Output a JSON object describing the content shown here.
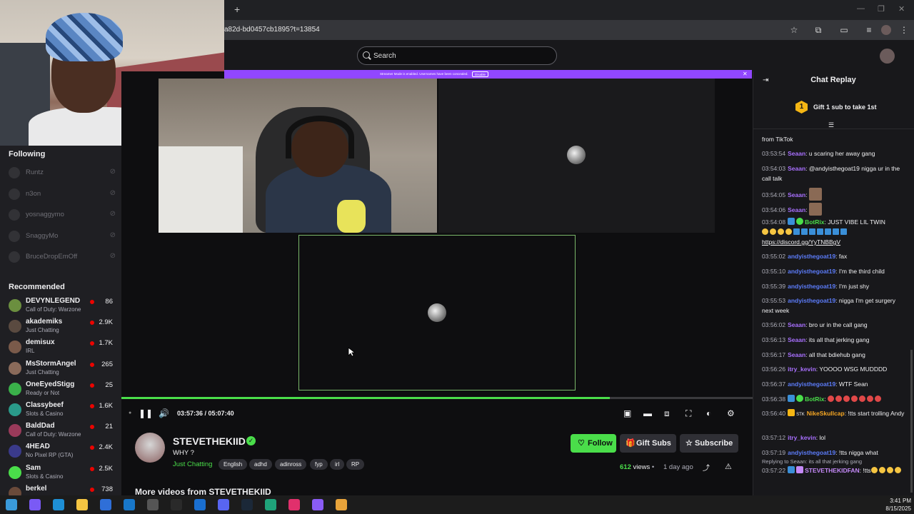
{
  "browser": {
    "url": "a82d-bd0457cb1895?t=13854",
    "new_tab": "+"
  },
  "header": {
    "search_placeholder": "Search"
  },
  "banner": {
    "text": "Streamer Mode is enabled. Usernames have been concealed.",
    "button": "Disable"
  },
  "sidebar": {
    "following_heading": "Following",
    "following": [
      {
        "name": "Runtz"
      },
      {
        "name": "n3on"
      },
      {
        "name": "yosnaggymo"
      },
      {
        "name": "SnaggyMo"
      },
      {
        "name": "BruceDropEmOff"
      }
    ],
    "recommended_heading": "Recommended",
    "recommended": [
      {
        "name": "DEVYNLEGEND",
        "category": "Call of Duty: Warzone",
        "viewers": "86",
        "color": "#6b8f3f"
      },
      {
        "name": "akademiks",
        "category": "Just Chatting",
        "viewers": "2.9K",
        "color": "#5a4a40"
      },
      {
        "name": "demisux",
        "category": "IRL",
        "viewers": "1.7K",
        "color": "#7a5a4a"
      },
      {
        "name": "MsStormAngel",
        "category": "Just Chatting",
        "viewers": "265",
        "color": "#8a6a5a"
      },
      {
        "name": "OneEyedStigg",
        "category": "Ready or Not",
        "viewers": "25",
        "color": "#3ab04a"
      },
      {
        "name": "Classybeef",
        "category": "Slots & Casino",
        "viewers": "1.6K",
        "color": "#2a9a8a"
      },
      {
        "name": "BaldDad",
        "category": "Call of Duty: Warzone",
        "viewers": "21",
        "color": "#9a3a5a"
      },
      {
        "name": "4HEAD",
        "category": "No Pixel RP (GTA)",
        "viewers": "2.4K",
        "color": "#3a3a8a"
      },
      {
        "name": "Sam",
        "category": "Slots & Casino",
        "viewers": "2.5K",
        "color": "#4ade4a"
      },
      {
        "name": "berkel",
        "category": "",
        "viewers": "738",
        "color": "#6a4a3a"
      }
    ]
  },
  "player": {
    "time_current": "03:57:36",
    "time_total": "05:07:40",
    "time_sep": " / ",
    "progress": 0.774
  },
  "channel": {
    "name": "STEVETHEKIID",
    "title": "WHY ?",
    "category": "Just Chatting",
    "tags": [
      "English",
      "adhd",
      "adinross",
      "fyp",
      "irl",
      "RP"
    ],
    "follow": "Follow",
    "gift": "Gift Subs",
    "subscribe": "Subscribe",
    "views": "612",
    "views_label": " views",
    "bullet": "•",
    "ago": "1 day ago",
    "more_videos": "More videos from STEVETHEKIID"
  },
  "chat": {
    "title": "Chat Replay",
    "gift_rank": "1",
    "gift_text": "Gift 1 sub to take 1st",
    "messages": [
      {
        "ts": "",
        "user": "",
        "color": "#9147ff",
        "text": "from TikTok"
      },
      {
        "ts": "03:53:54",
        "user": "Seaan",
        "color": "#a970ff",
        "text": "u scaring her away gang"
      },
      {
        "ts": "03:54:03",
        "user": "Seaan",
        "color": "#a970ff",
        "text": "@andyisthegoat19 nigga ur in the call talk"
      },
      {
        "ts": "03:54:05",
        "user": "Seaan",
        "color": "#a970ff",
        "text": ""
      },
      {
        "ts": "03:54:06",
        "user": "Seaan",
        "color": "#a970ff",
        "text": ""
      },
      {
        "ts": "03:54:08",
        "user": "BotRix",
        "color": "#4ade4a",
        "text": "JUST VIBE LIL TWIN",
        "link": "https://discord.gg/YyTNBBgV"
      },
      {
        "ts": "03:55:02",
        "user": "andyisthegoat19",
        "color": "#5c7cfa",
        "text": "fax"
      },
      {
        "ts": "03:55:10",
        "user": "andyisthegoat19",
        "color": "#5c7cfa",
        "text": "I'm the third child"
      },
      {
        "ts": "03:55:39",
        "user": "andyisthegoat19",
        "color": "#5c7cfa",
        "text": "I'm just shy"
      },
      {
        "ts": "03:55:53",
        "user": "andyisthegoat19",
        "color": "#5c7cfa",
        "text": "nigga I'm get surgery next week"
      },
      {
        "ts": "03:56:02",
        "user": "Seaan",
        "color": "#a970ff",
        "text": "bro ur in the call gang"
      },
      {
        "ts": "03:56:13",
        "user": "Seaan",
        "color": "#a970ff",
        "text": "its all that jerking gang"
      },
      {
        "ts": "03:56:17",
        "user": "Seaan",
        "color": "#a970ff",
        "text": "all that bdiehub gang"
      },
      {
        "ts": "03:56:26",
        "user": "itry_kevin",
        "color": "#a970ff",
        "text": "YOOOO WSG MUDDDD"
      },
      {
        "ts": "03:56:37",
        "user": "andyisthegoat19",
        "color": "#5c7cfa",
        "text": "WTF Sean"
      },
      {
        "ts": "03:56:38",
        "user": "BotRix",
        "color": "#4ade4a",
        "text": ""
      },
      {
        "ts": "03:56:40",
        "user": "NikeSkullcap",
        "color": "#f5a623",
        "text": "!tts start trolling Andy",
        "badge_text": "STK"
      },
      {
        "ts": "03:57:12",
        "user": "itry_kevin",
        "color": "#a970ff",
        "text": "lol"
      },
      {
        "ts": "03:57:19",
        "user": "andyisthegoat19",
        "color": "#5c7cfa",
        "text": "!tts nigga what"
      },
      {
        "ts": "03:57:22",
        "user": "STEVETHEKIDFAN",
        "color": "#c58af9",
        "text": "!tts",
        "reply": "Replying to Seaan: its all that jerking gang"
      }
    ]
  },
  "taskbar": {
    "time": "3:41 PM",
    "date": "8/15/2025"
  },
  "colors": {
    "accent": "#4ade4a",
    "purple": "#9147ff",
    "background": "#0e0e10"
  }
}
